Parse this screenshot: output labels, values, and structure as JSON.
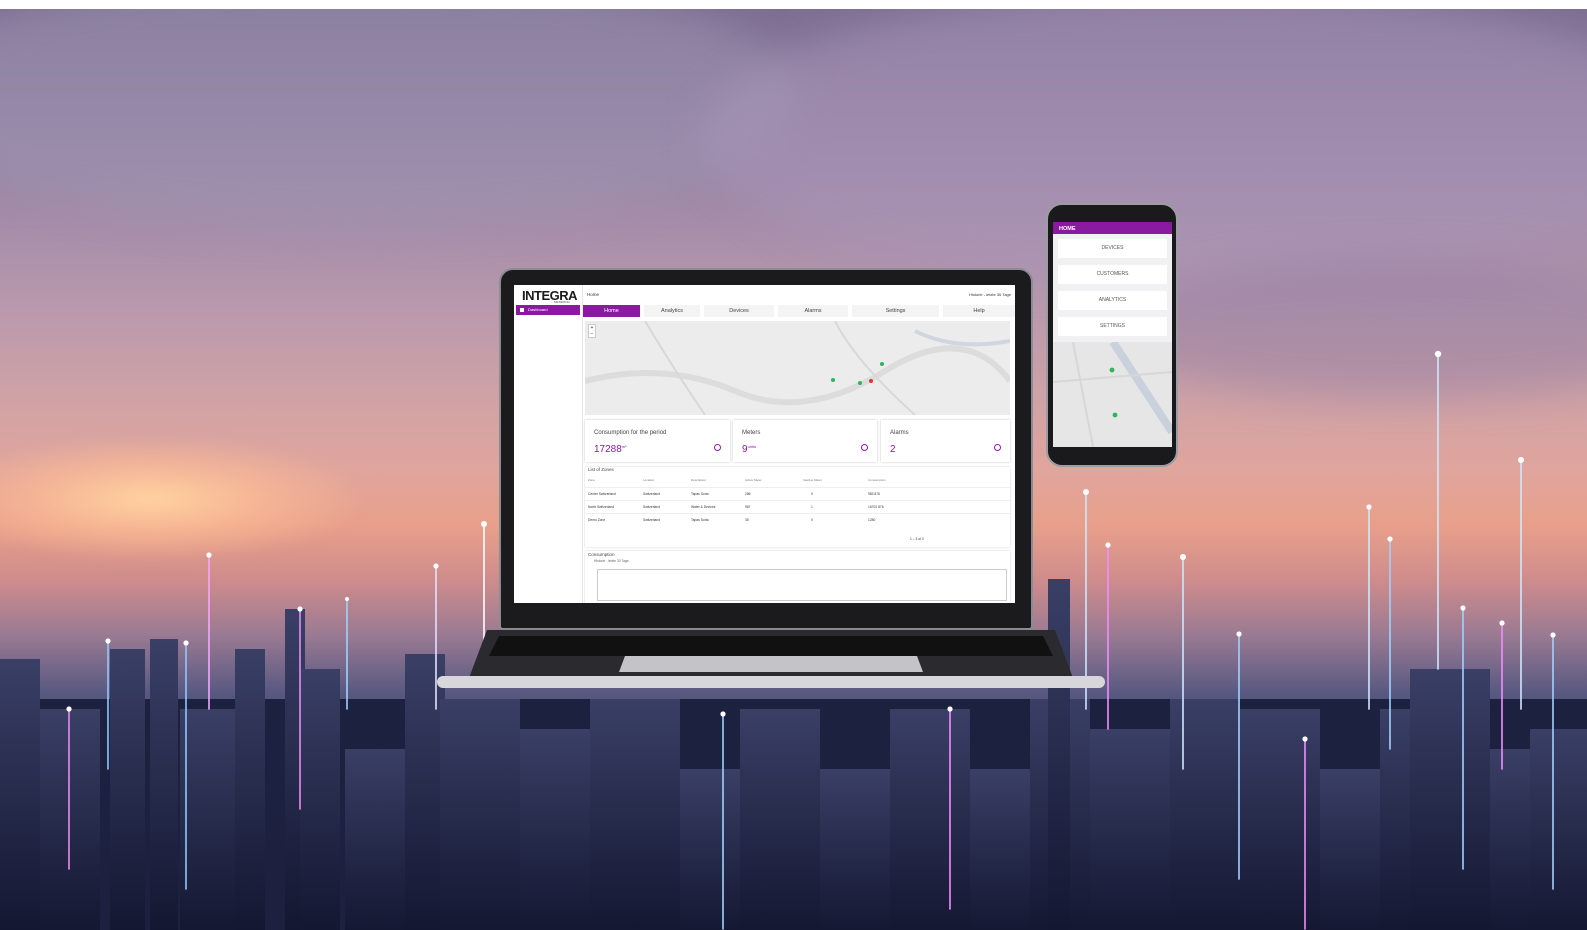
{
  "laptop_app": {
    "brand": "INTEGRA",
    "brand_sub": "METERING",
    "sidebar": {
      "items": [
        {
          "label": "Dashboard",
          "icon": "home-icon",
          "active": true
        }
      ]
    },
    "breadcrumb": "Home",
    "history_label": "Historie - letzte 30 Tage",
    "tabs": [
      {
        "label": "Home",
        "active": true
      },
      {
        "label": "Analytics",
        "active": false
      },
      {
        "label": "Devices",
        "active": false
      },
      {
        "label": "Alarms",
        "active": false
      },
      {
        "label": "Settings",
        "active": false
      },
      {
        "label": "Help",
        "active": false
      }
    ],
    "map": {
      "zoom_in": "+",
      "zoom_out": "−"
    },
    "cards": [
      {
        "title": "Consumption for the period",
        "value": "17288",
        "unit": "m³",
        "icon": "water-drop-icon"
      },
      {
        "title": "Meters",
        "value": "9",
        "unit": "units",
        "icon": "gauge-icon"
      },
      {
        "title": "Alarms",
        "value": "2",
        "unit": "",
        "icon": "bell-icon"
      }
    ],
    "zones": {
      "title": "List of Zones",
      "columns": [
        "Zone",
        "Location",
        "Description",
        "Active Meter",
        "Inactive Meter",
        "Consumption"
      ],
      "rows": [
        [
          "Center Switzerland",
          "Switzerland",
          "Tapas Sonic",
          "286",
          "0",
          "983 876"
        ],
        [
          "North Switzerland",
          "Switzerland",
          "Water & Devices",
          "987",
          "1",
          "16702 876"
        ],
        [
          "Demo Zone",
          "Switzerland",
          "Tapas Sonic",
          "35",
          "0",
          "1280"
        ]
      ],
      "pagination": "1 – 3 of 3"
    },
    "consumption": {
      "title": "Consumption",
      "history_label": "Historie - letzte 30 Tage"
    }
  },
  "phone_app": {
    "header": "HOME",
    "menu": [
      "DEVICES",
      "CUSTOMERS",
      "ANALYTICS",
      "SETTINGS"
    ]
  },
  "colors": {
    "accent": "#8a1aa0",
    "sky_top": "#7d6f93",
    "sunset": "#e8a08b",
    "city": "#171b38"
  }
}
